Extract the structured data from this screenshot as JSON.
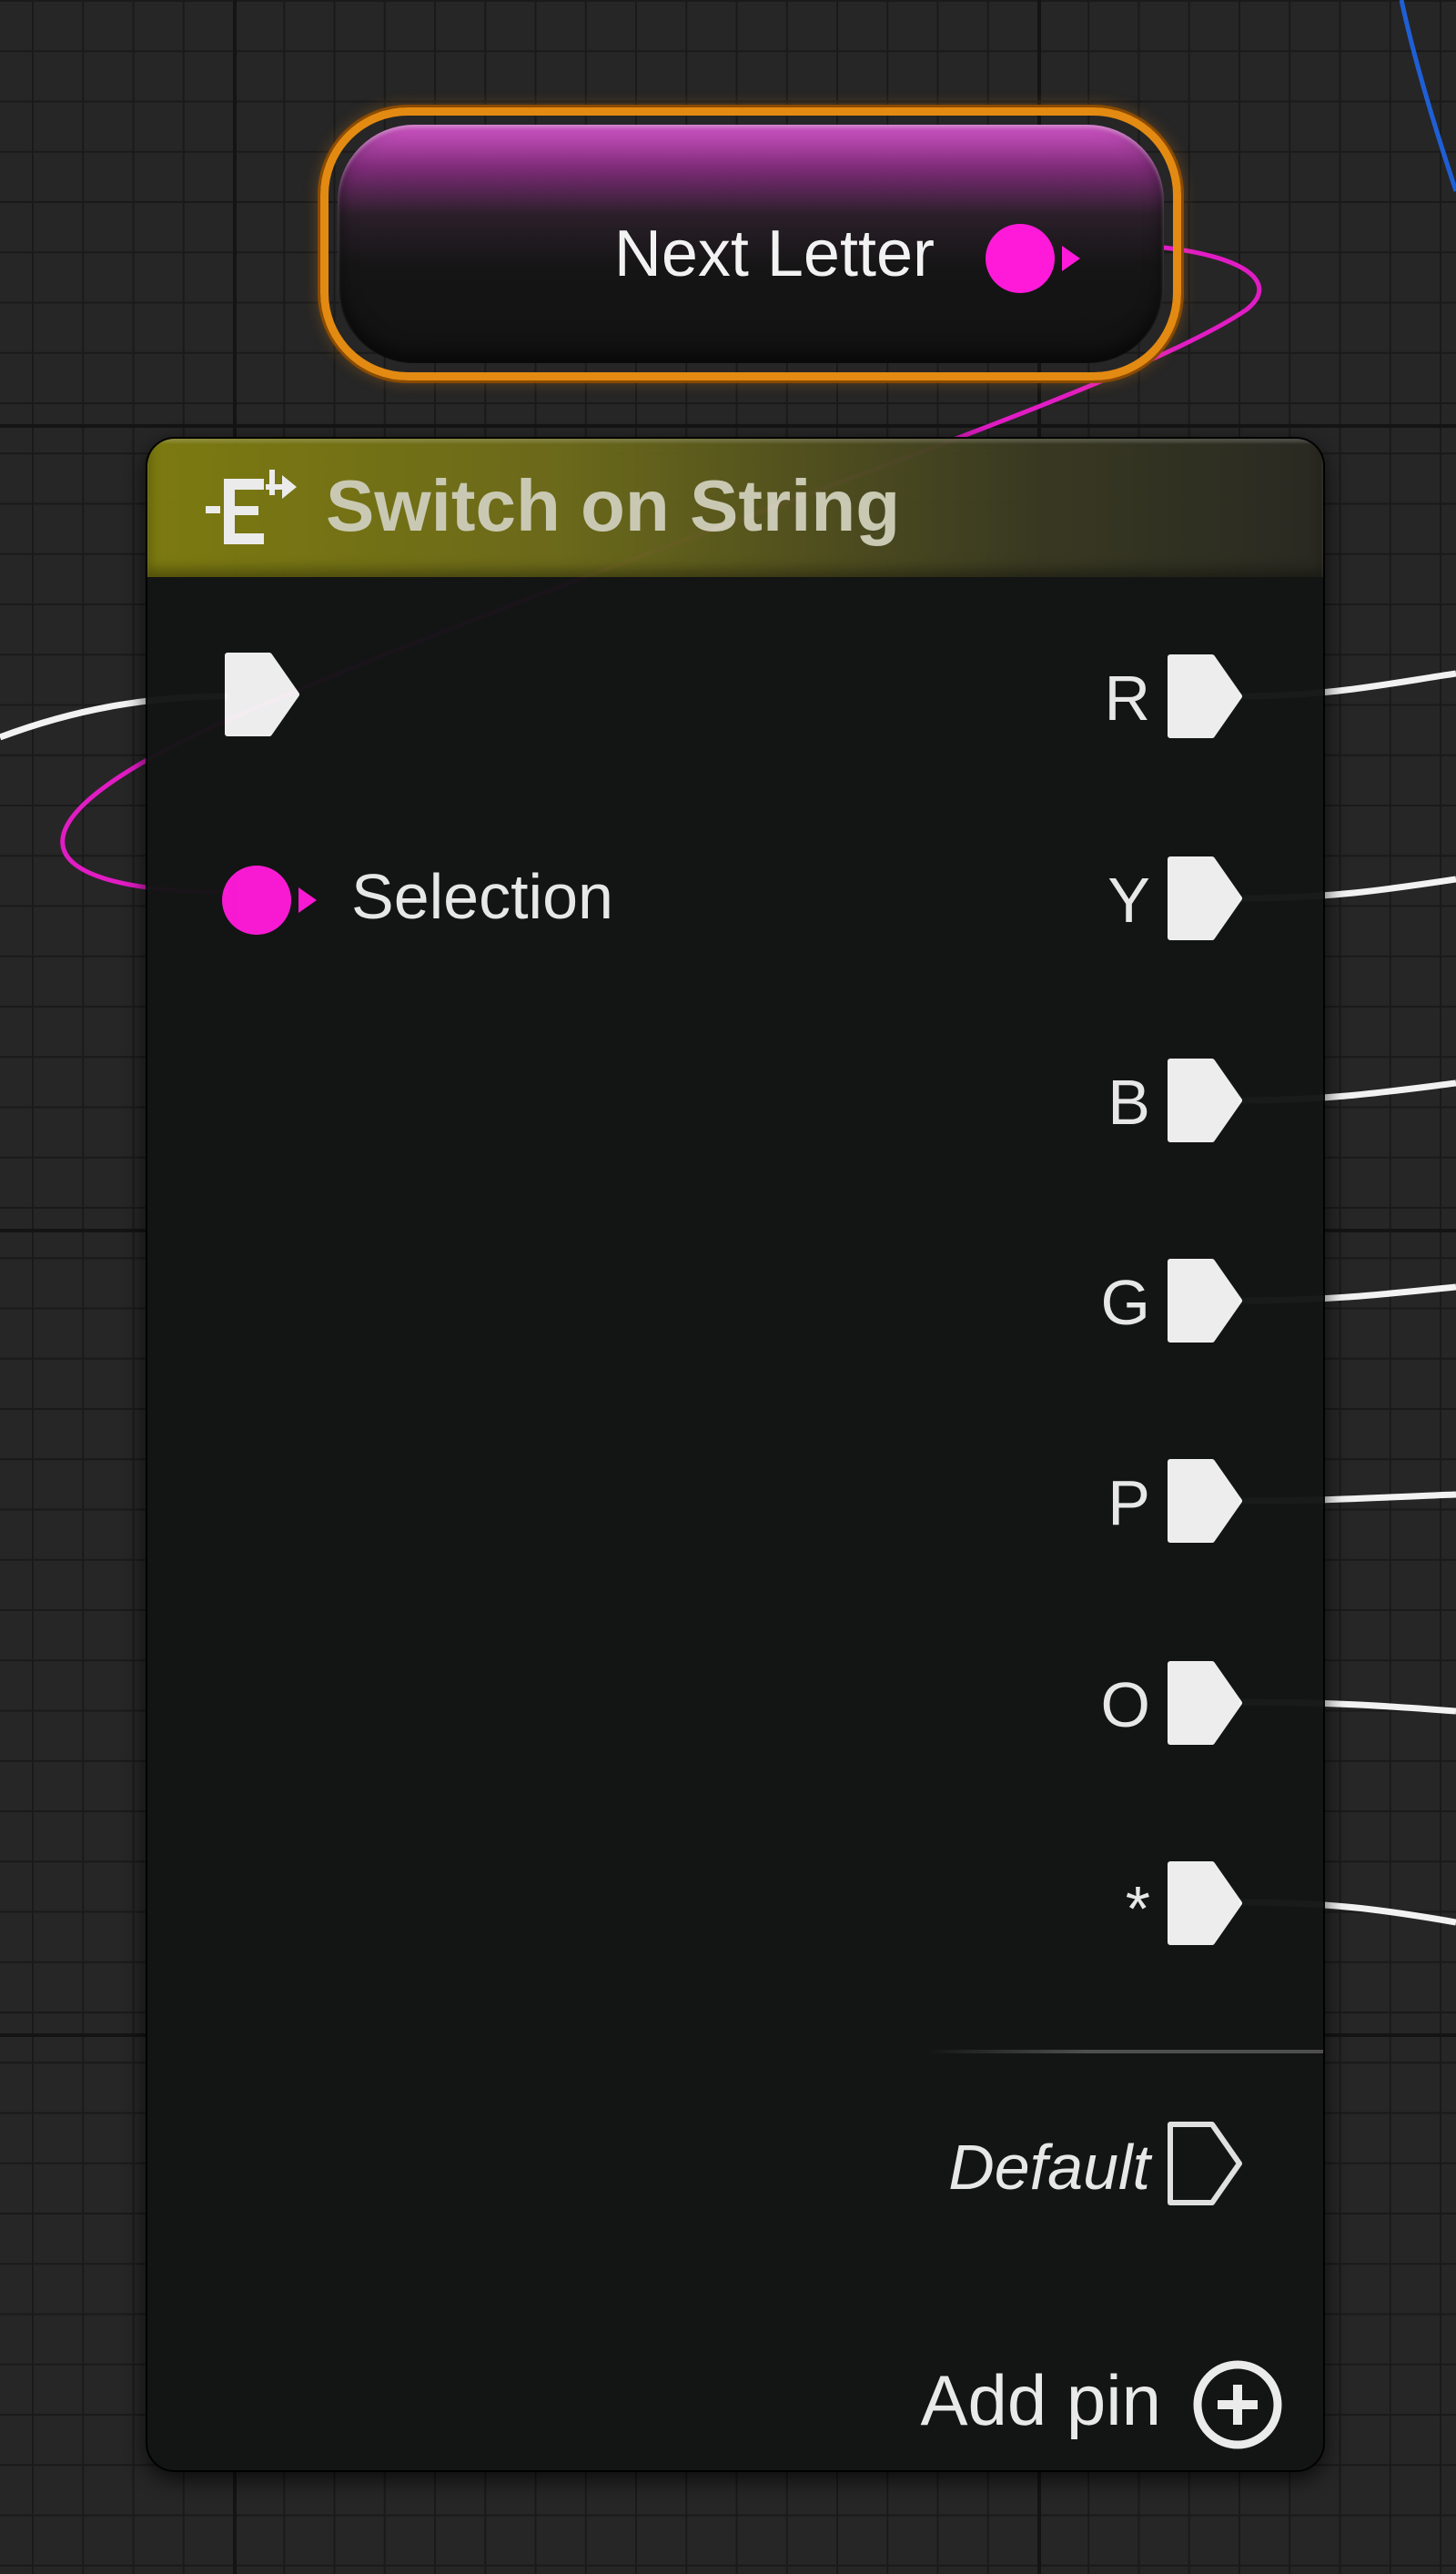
{
  "graph": {
    "variable_node": {
      "label": "Next Letter",
      "pin_color": "#ff1ad9",
      "border_color": "#e38a12"
    },
    "switch_node": {
      "title": "Switch on String",
      "header_color": "#7f7d10",
      "icon": "switch-icon",
      "inputs": {
        "exec_icon": "exec-pin-icon",
        "selection_label": "Selection",
        "selection_pin_color": "#ff1ad9"
      },
      "outputs": [
        {
          "label": "R"
        },
        {
          "label": "Y"
        },
        {
          "label": "B"
        },
        {
          "label": "G"
        },
        {
          "label": "P"
        },
        {
          "label": "O"
        },
        {
          "label": "*"
        }
      ],
      "default_label": "Default",
      "add_pin_label": "Add pin",
      "add_pin_icon": "plus-circle-icon"
    },
    "wire_colors": {
      "exec": "#f2f2f2",
      "string": "#ff1ad9",
      "other": "#1f5fd6"
    }
  }
}
